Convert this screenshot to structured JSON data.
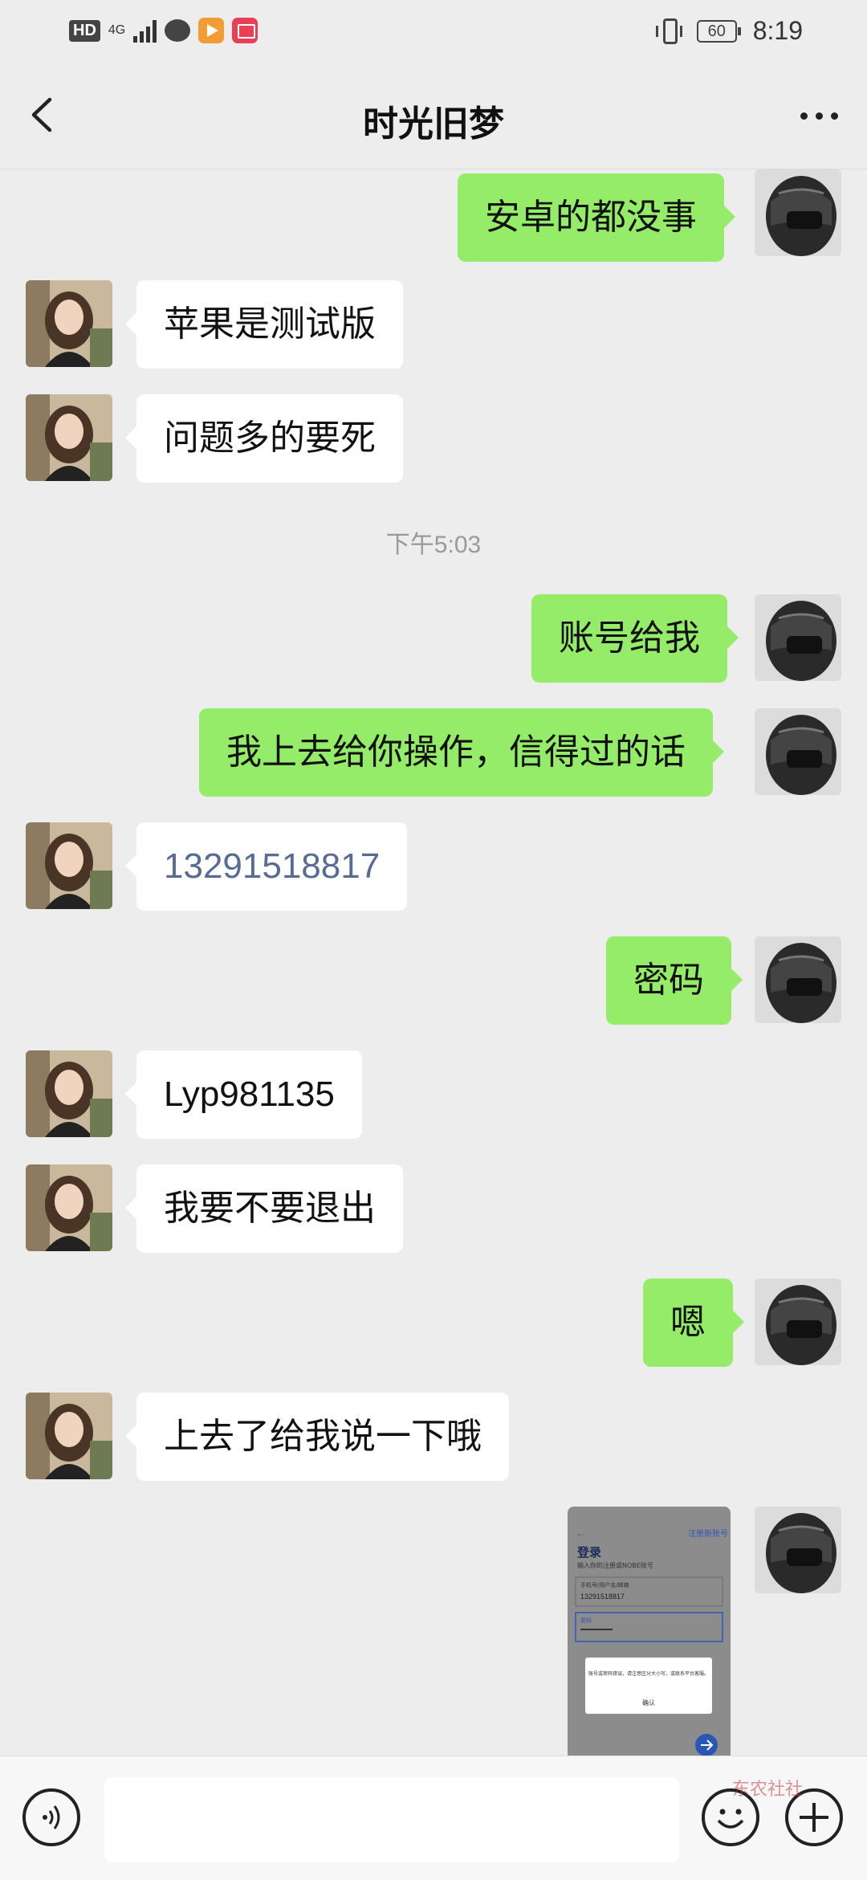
{
  "status_bar": {
    "hd": "HD",
    "network": "4G",
    "battery": "60",
    "time": "8:19"
  },
  "header": {
    "title": "时光旧梦"
  },
  "messages": [
    {
      "side": "out",
      "text": "安卓的都没事"
    },
    {
      "side": "in",
      "text": "苹果是测试版"
    },
    {
      "side": "in",
      "text": "问题多的要死"
    },
    {
      "type": "time",
      "text": "下午5:03"
    },
    {
      "side": "out",
      "text": "账号给我"
    },
    {
      "side": "out",
      "text": "我上去给你操作，信得过的话"
    },
    {
      "side": "in",
      "text": "13291518817"
    },
    {
      "side": "out",
      "text": "密码"
    },
    {
      "side": "in",
      "text": "Lyp981135"
    },
    {
      "side": "in",
      "text": "我要不要退出"
    },
    {
      "side": "out",
      "text": "嗯"
    },
    {
      "side": "in",
      "text": "上去了给我说一下哦"
    },
    {
      "side": "out",
      "type": "image"
    }
  ],
  "image_message": {
    "register": "注册新账号",
    "title": "登录",
    "subtitle": "输入你的注册或NOBE账号",
    "field_label": "手机号/用户名/邮箱",
    "account_value": "13291518817",
    "password_label": "密码",
    "dialog_text": "账号或密码错误，请注意区分大小写，或联系平台客服。",
    "dialog_confirm": "确认"
  },
  "watermark": "东农社社",
  "colors": {
    "background": "#ededed",
    "bubble_out": "#95ec69",
    "bubble_in": "#ffffff",
    "phone_link": "#576b95"
  },
  "icons": {
    "back": "chevron-left-icon",
    "more": "more-icon",
    "voice": "voice-icon",
    "emoji": "emoji-icon",
    "plus": "plus-icon"
  }
}
